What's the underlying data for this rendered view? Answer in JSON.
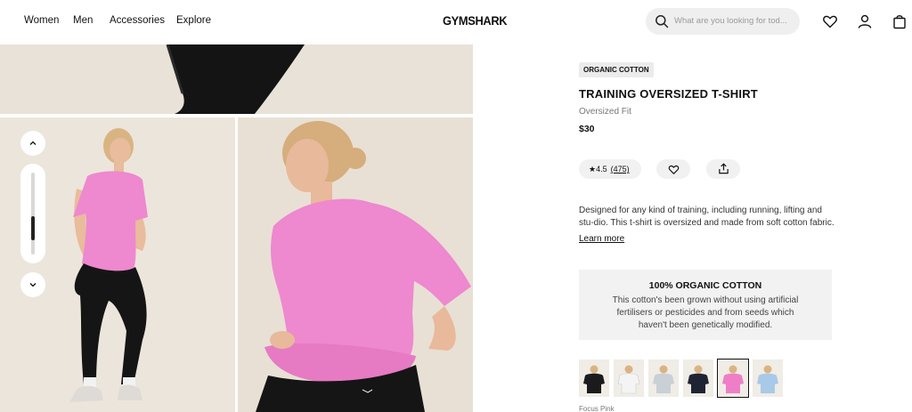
{
  "nav": {
    "items": [
      "Women",
      "Men",
      "Accessories",
      "Explore"
    ]
  },
  "brand": {
    "logo": "GYMSHARK"
  },
  "search": {
    "placeholder": "What are you looking for tod..."
  },
  "header_icons": [
    "heart-icon",
    "user-icon",
    "bag-icon"
  ],
  "gallery": {
    "images": [
      "top-crop-model-leggings",
      "model-standing-pink-tee",
      "model-closeup-pink-tee"
    ],
    "thumbnail_scroll": {
      "position_fraction": 0.75
    }
  },
  "product": {
    "badge": "ORGANIC COTTON",
    "title": "TRAINING OVERSIZED T-SHIRT",
    "fit": "Oversized Fit",
    "price": "$30",
    "rating": "4.5",
    "reviews": "(475)",
    "description": "Designed for any kind of training, including running, lifting and stu-dio. This t-shirt is oversized and made from soft cotton fabric.",
    "learn_more": "Learn more"
  },
  "info_box": {
    "title": "100% ORGANIC COTTON",
    "text": "This cotton's been grown without using artificial fertilisers or pesticides and from seeds which haven't been genetically modified."
  },
  "colors": {
    "swatches": [
      {
        "name": "Black",
        "hex": "#1b1b1b"
      },
      {
        "name": "White",
        "hex": "#f4f4f4"
      },
      {
        "name": "Light Grey",
        "hex": "#c9d0d6"
      },
      {
        "name": "Navy",
        "hex": "#1f2433"
      },
      {
        "name": "Focus Pink",
        "hex": "#ee7fc7",
        "selected": true
      },
      {
        "name": "Light Blue",
        "hex": "#a9c9e8"
      }
    ],
    "selected_label": "Focus Pink"
  },
  "theme": {
    "pink": "#ee88cf",
    "legging": "#151515",
    "skin": "#e8b99a",
    "hair": "#d9b483"
  }
}
